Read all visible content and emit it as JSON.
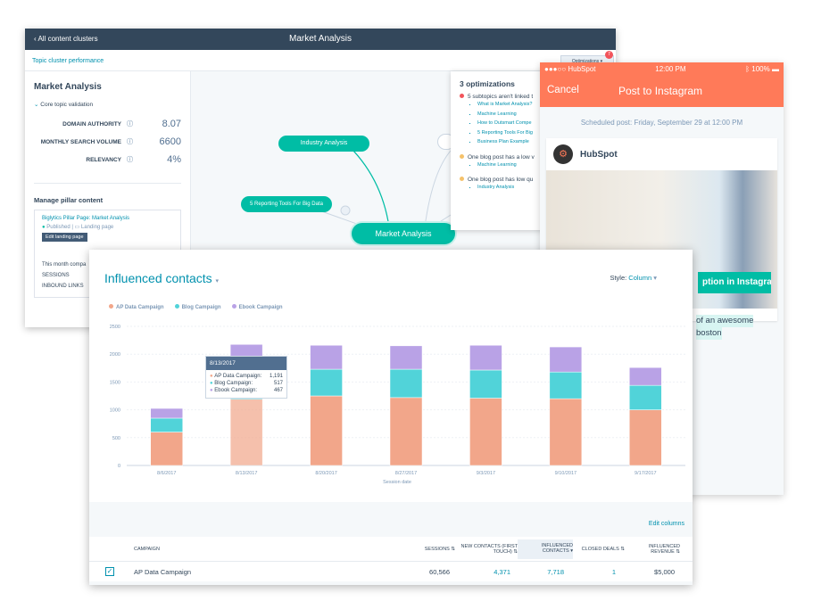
{
  "back_window": {
    "back_label": "All content clusters",
    "title": "Market Analysis",
    "subnav": "Topic cluster performance",
    "optimizations_button": "Optimizations",
    "optimizations_badge": "7",
    "left": {
      "title": "Market Analysis",
      "section": "Core topic validation",
      "metrics": [
        {
          "label": "DOMAIN AUTHORITY",
          "value": "8.07"
        },
        {
          "label": "MONTHLY SEARCH VOLUME",
          "value": "6600"
        },
        {
          "label": "RELEVANCY",
          "value": "4%"
        }
      ],
      "manage_title": "Manage pillar content",
      "pillar_link": "Biglytics Pillar Page: Market Analysis",
      "status": "Published",
      "page_type": "Landing page",
      "edit_button": "Edit landing page",
      "month_text": "This month compa",
      "sessions_label": "SESSIONS",
      "inbound_label": "INBOUND LINKS"
    },
    "nodes": {
      "industry": "Industry Analysis",
      "reporting": "5 Reporting Tools For Big Data",
      "center": "Market Analysis"
    },
    "optimizations": {
      "title": "3 optimizations",
      "items": [
        {
          "text": "5 subtopics aren't linked t",
          "color": "#f2545b",
          "links": [
            "What is Market Analysis?",
            "Machine Learning",
            "How to Outsmart Compe",
            "5 Reporting Tools For Big",
            "Business Plan Example"
          ]
        },
        {
          "text": "One blog post has a low v",
          "color": "#f5c26b",
          "links": [
            "Machine Learning"
          ]
        },
        {
          "text": "One blog post has low qu",
          "color": "#f5c26b",
          "links": [
            "Industry Analysis"
          ]
        }
      ]
    }
  },
  "phone": {
    "carrier": "●●●○○ HubSpot",
    "time": "12:00 PM",
    "battery": "100%",
    "cancel": "Cancel",
    "title": "Post to Instagram",
    "scheduled": "Scheduled post: Friday, September 29 at 12:00 PM",
    "account": "HubSpot",
    "overlay_text": "ption in Instagram.",
    "caption_line1": "of an awesome",
    "caption_line2": "boston"
  },
  "chart_card": {
    "title": "Influenced contacts",
    "style_label": "Style:",
    "style_value": "Column",
    "tooltip": {
      "date": "8/13/2017",
      "rows": [
        {
          "label": "AP Data Campaign:",
          "value": "1,191",
          "color": "#f2a68a"
        },
        {
          "label": "Blog Campaign:",
          "value": "517",
          "color": "#51d3d9"
        },
        {
          "label": "Ebook Campaign:",
          "value": "467",
          "color": "#b9a2e6"
        }
      ]
    },
    "edit_columns": "Edit columns",
    "table": {
      "headers": [
        "CAMPAIGN",
        "SESSIONS",
        "NEW CONTACTS (FIRST TOUCH)",
        "INFLUENCED CONTACTS",
        "CLOSED DEALS",
        "INFLUENCED REVENUE"
      ],
      "rows": [
        {
          "campaign": "AP Data Campaign",
          "sessions": "60,566",
          "new_contacts": "4,371",
          "influenced": "7,718",
          "closed": "1",
          "revenue": "$5,000"
        }
      ]
    }
  },
  "chart_data": {
    "type": "bar",
    "stacked": true,
    "title": "Influenced contacts",
    "xlabel": "Session date",
    "ylabel": "",
    "categories": [
      "8/6/2017",
      "8/13/2017",
      "8/20/2017",
      "8/27/2017",
      "9/3/2017",
      "9/10/2017",
      "9/17/2017"
    ],
    "ylim": [
      0,
      2500
    ],
    "yticks": [
      0,
      500,
      1000,
      1500,
      2000,
      2500
    ],
    "grid": true,
    "legend": "top-left",
    "series": [
      {
        "name": "AP Data Campaign",
        "color": "#f2a68a",
        "values": [
          600,
          1191,
          1250,
          1220,
          1210,
          1200,
          1000
        ]
      },
      {
        "name": "Blog Campaign",
        "color": "#51d3d9",
        "values": [
          250,
          517,
          480,
          510,
          505,
          480,
          440
        ]
      },
      {
        "name": "Ebook Campaign",
        "color": "#b9a2e6",
        "values": [
          175,
          467,
          430,
          420,
          445,
          450,
          320
        ]
      }
    ]
  }
}
